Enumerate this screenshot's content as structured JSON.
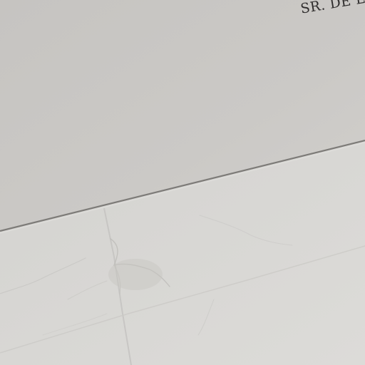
{
  "scene": {
    "engraved_text": "SR. DE LA",
    "colors": {
      "wall": "#cdcbc8",
      "floor": "#d9d8d5",
      "skirting_line": "#7d7b78",
      "text": "#2e2c2c"
    }
  }
}
